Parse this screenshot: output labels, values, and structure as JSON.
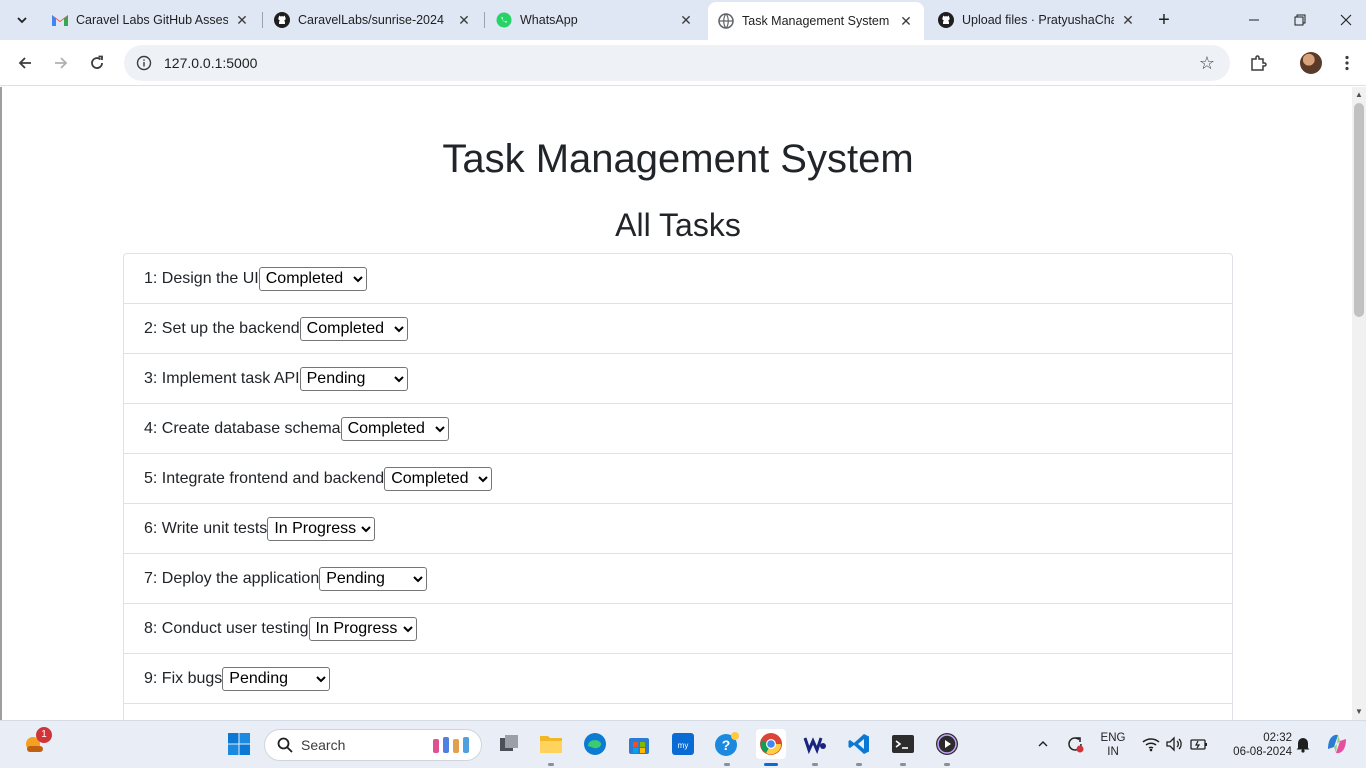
{
  "browser": {
    "tabs": [
      {
        "title": "Caravel Labs GitHub Assessm",
        "icon": "gmail-icon"
      },
      {
        "title": "CaravelLabs/sunrise-2024",
        "icon": "github-icon"
      },
      {
        "title": "WhatsApp",
        "icon": "whatsapp-icon"
      },
      {
        "title": "Task Management System",
        "icon": "globe-icon",
        "active": true
      },
      {
        "title": "Upload files · PratyushaChat",
        "icon": "github-icon"
      }
    ],
    "url": "127.0.0.1:5000"
  },
  "page": {
    "title": "Task Management System",
    "section_title": "All Tasks",
    "tasks": [
      {
        "label": "1: Design the UI",
        "status": "Completed"
      },
      {
        "label": "2: Set up the backend",
        "status": "Completed"
      },
      {
        "label": "3: Implement task API",
        "status": "Pending"
      },
      {
        "label": "4: Create database schema",
        "status": "Completed"
      },
      {
        "label": "5: Integrate frontend and backend",
        "status": "Completed"
      },
      {
        "label": "6: Write unit tests",
        "status": "In Progress"
      },
      {
        "label": "7: Deploy the application",
        "status": "Pending"
      },
      {
        "label": "8: Conduct user testing",
        "status": "In Progress"
      },
      {
        "label": "9: Fix bugs",
        "status": "Pending"
      },
      {
        "label": "",
        "status": ""
      }
    ],
    "status_options": [
      "Pending",
      "In Progress",
      "Completed"
    ]
  },
  "taskbar": {
    "search_placeholder": "Search",
    "notification_badge": "1",
    "language_line1": "ENG",
    "language_line2": "IN",
    "time": "02:32",
    "date": "06-08-2024"
  },
  "colors": {
    "tabstrip_bg": "#dfe7f5",
    "text": "#212529",
    "border": "#dee2e6"
  }
}
